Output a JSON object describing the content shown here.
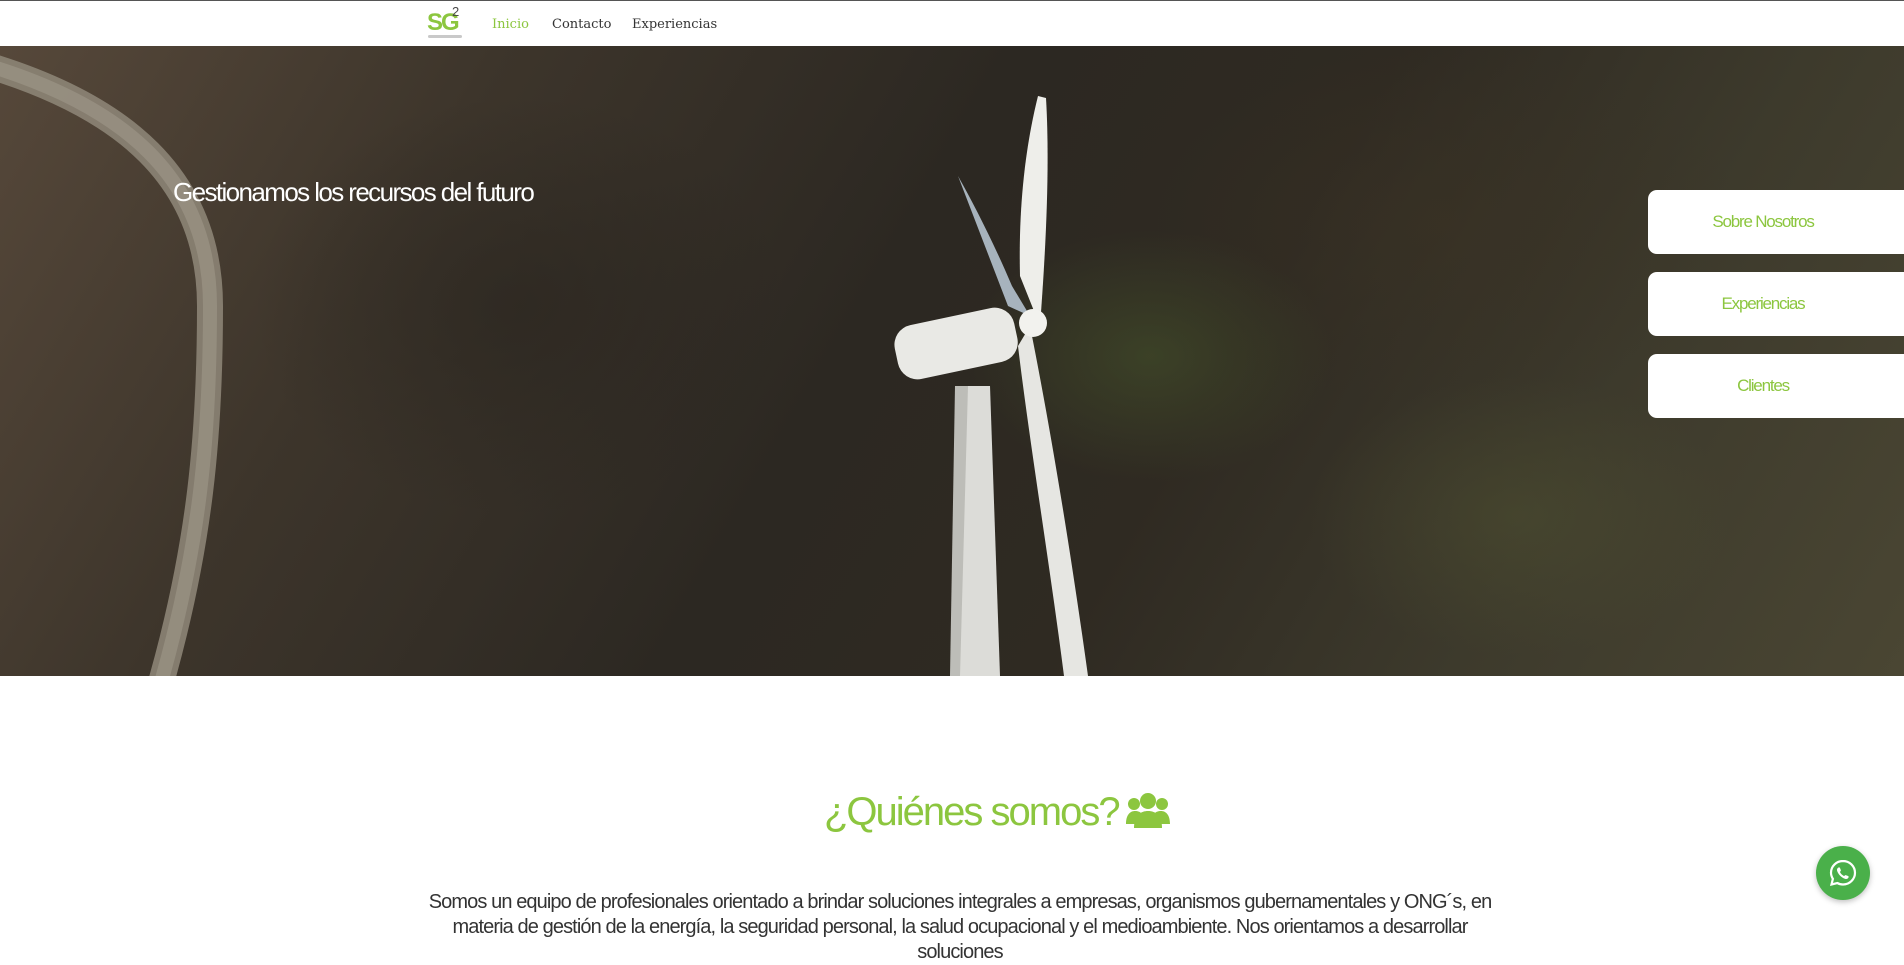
{
  "nav": {
    "logo": {
      "main": "SG",
      "sup": "2"
    },
    "links": [
      {
        "label": "Inicio",
        "active": true
      },
      {
        "label": "Contacto",
        "active": false
      },
      {
        "label": "Experiencias",
        "active": false
      }
    ]
  },
  "hero": {
    "title": "Gestionamos los recursos del futuro",
    "buttons": [
      {
        "label": "Sobre Nosotros"
      },
      {
        "label": "Experiencias"
      },
      {
        "label": "Clientes"
      }
    ]
  },
  "about": {
    "title": "¿Quiénes somos?",
    "icon": "users-group-icon",
    "text": "Somos un equipo de profesionales orientado a brindar soluciones integrales a empresas, organismos gubernamentales y ONG´s, en materia de gestión de la energía, la seguridad personal, la salud ocupacional y el medioambiente. Nos orientamos a desarrollar soluciones"
  },
  "floating": {
    "icon": "whatsapp-icon"
  },
  "colors": {
    "accent": "#8cc63f",
    "whatsapp": "#4ab04a"
  }
}
